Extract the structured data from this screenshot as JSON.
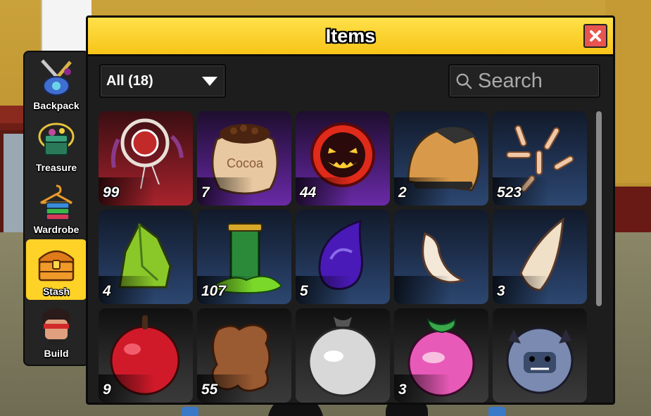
{
  "window": {
    "title": "Items",
    "close_icon": "close-x-icon",
    "accent_color": "#f7c418"
  },
  "sidebar": {
    "items": [
      {
        "label": "Backpack",
        "icon": "backpack-swords-icon",
        "active": false
      },
      {
        "label": "Treasure",
        "icon": "treasure-gem-icon",
        "active": false
      },
      {
        "label": "Wardrobe",
        "icon": "hanger-clothes-icon",
        "active": false
      },
      {
        "label": "Stash",
        "icon": "treasure-chest-icon",
        "active": true
      },
      {
        "label": "Build",
        "icon": "character-head-icon",
        "active": false
      }
    ]
  },
  "filter": {
    "selected": "All (18)"
  },
  "search": {
    "placeholder": "Search"
  },
  "items": [
    {
      "icon": "dreamcatcher-icon",
      "count": "99",
      "rarity_color": "#a8232c"
    },
    {
      "icon": "cocoa-bag-icon",
      "count": "7",
      "rarity_color": "#6a2aa6"
    },
    {
      "icon": "flaming-pumpkin-icon",
      "count": "44",
      "rarity_color": "#6a2aa6"
    },
    {
      "icon": "hood-cloth-icon",
      "count": "2",
      "rarity_color": "#2c4770"
    },
    {
      "icon": "bones-icon",
      "count": "523",
      "rarity_color": "#2c4770"
    },
    {
      "icon": "green-crystal-icon",
      "count": "4",
      "rarity_color": "#2c4770"
    },
    {
      "icon": "slime-goblet-icon",
      "count": "107",
      "rarity_color": "#2c4770"
    },
    {
      "icon": "purple-droplet-icon",
      "count": "5",
      "rarity_color": "#2c4770"
    },
    {
      "icon": "small-fang-icon",
      "count": "",
      "rarity_color": "#2c4770"
    },
    {
      "icon": "large-fang-icon",
      "count": "3",
      "rarity_color": "#2c4770"
    },
    {
      "icon": "red-apple-icon",
      "count": "9",
      "rarity_color": "#3a3a3a"
    },
    {
      "icon": "leather-hide-icon",
      "count": "55",
      "rarity_color": "#3a3a3a"
    },
    {
      "icon": "silver-fruit-icon",
      "count": "",
      "rarity_color": "#3a3a3a"
    },
    {
      "icon": "pink-fruit-icon",
      "count": "3",
      "rarity_color": "#3a3a3a"
    },
    {
      "icon": "yeti-head-icon",
      "count": "",
      "rarity_color": "#3a3a3a"
    }
  ]
}
